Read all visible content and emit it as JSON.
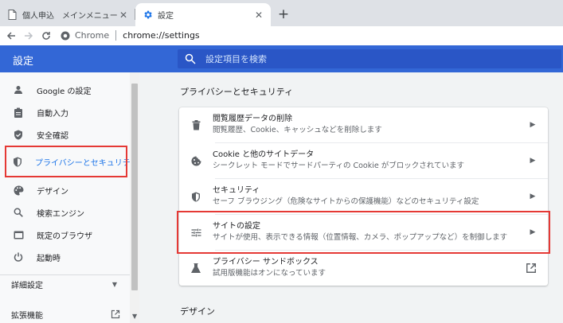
{
  "browser": {
    "tabs": [
      {
        "title": "個人申込　メインメニュー",
        "active": false,
        "icon": "document-icon"
      },
      {
        "title": "設定",
        "active": true,
        "icon": "gear-icon"
      }
    ],
    "new_tab_label": "+",
    "close_glyph": "✕",
    "omnibox": {
      "chip": "Chrome",
      "url": "chrome://settings"
    }
  },
  "header": {
    "title": "設定",
    "search_placeholder": "設定項目を検索"
  },
  "sidebar": {
    "items": [
      {
        "label": "Google の設定",
        "icon": "person-icon"
      },
      {
        "label": "自動入力",
        "icon": "clipboard-icon"
      },
      {
        "label": "安全確認",
        "icon": "shield-check-icon"
      },
      {
        "label": "プライバシーとセキュリティ",
        "icon": "shield-icon",
        "selected": true
      },
      {
        "label": "デザイン",
        "icon": "palette-icon"
      },
      {
        "label": "検索エンジン",
        "icon": "search-icon"
      },
      {
        "label": "既定のブラウザ",
        "icon": "browser-icon"
      },
      {
        "label": "起動時",
        "icon": "power-icon"
      }
    ],
    "advanced_label": "詳細設定",
    "extensions_label": "拡張機能"
  },
  "main": {
    "section_title": "プライバシーとセキュリティ",
    "rows": [
      {
        "title": "閲覧履歴データの削除",
        "subtitle": "閲覧履歴、Cookie、キャッシュなどを削除します",
        "icon": "trash-icon",
        "action": "arrow"
      },
      {
        "title": "Cookie と他のサイトデータ",
        "subtitle": "シークレット モードでサードパーティの Cookie がブロックされています",
        "icon": "cookie-icon",
        "action": "arrow"
      },
      {
        "title": "セキュリティ",
        "subtitle": "セーフ ブラウジング（危険なサイトからの保護機能）などのセキュリティ設定",
        "icon": "shield-icon",
        "action": "arrow"
      },
      {
        "title": "サイトの設定",
        "subtitle": "サイトが使用、表示できる情報（位置情報、カメラ、ポップアップなど）を制御します",
        "icon": "tune-icon",
        "action": "arrow"
      },
      {
        "title": "プライバシー サンドボックス",
        "subtitle": "試用版機能はオンになっています",
        "icon": "flask-icon",
        "action": "external"
      }
    ],
    "next_section_title": "デザイン"
  },
  "colors": {
    "header_blue": "#3367d6",
    "highlight_red": "#e53935"
  }
}
